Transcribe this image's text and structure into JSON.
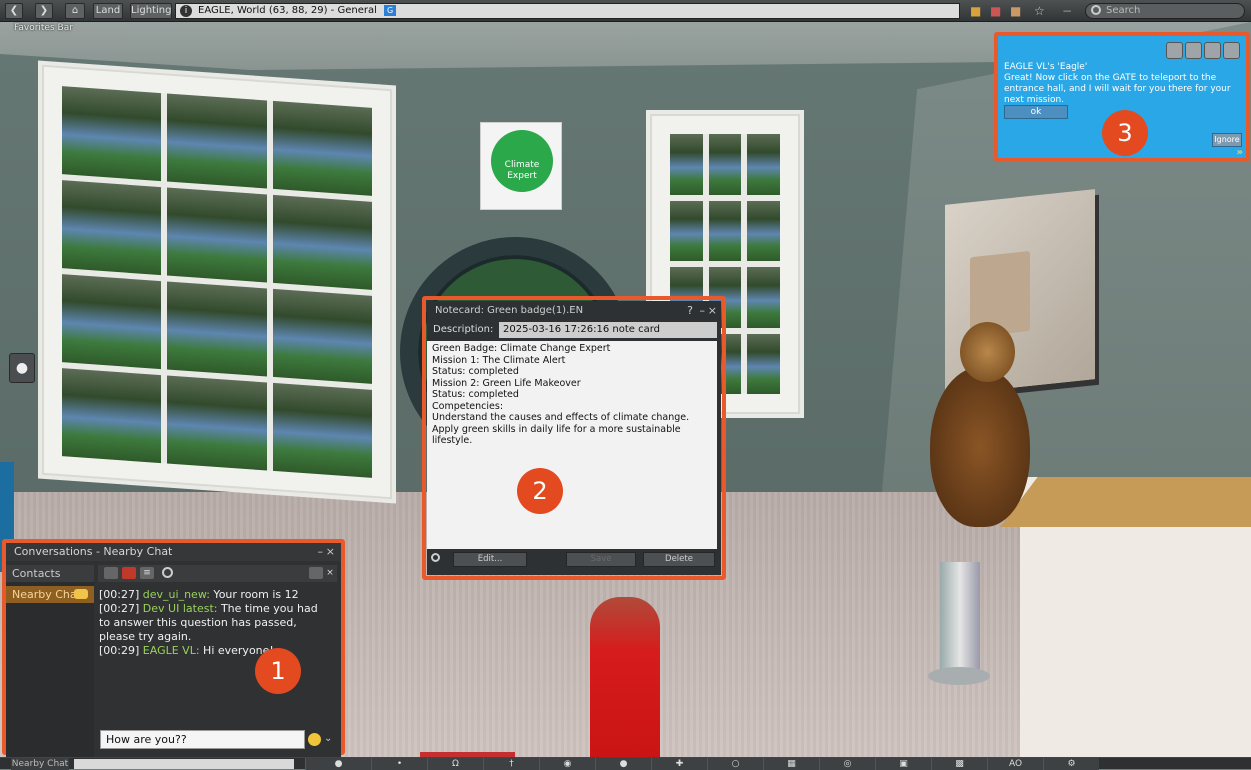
{
  "topbar": {
    "back_icon": "chevron-left-icon",
    "forward_icon": "chevron-right-icon",
    "home_icon": "home-icon",
    "land_label": "Land",
    "lighting_label": "Lighting",
    "location": "EAGLE, World (63, 88, 29) - General",
    "rating_badge": "G",
    "search_placeholder": "Search",
    "favorites_label": "Favorites Bar"
  },
  "conversations": {
    "title": "Conversations - Nearby Chat",
    "contacts_label": "Contacts",
    "active_tab": "Nearby Chat",
    "messages": [
      {
        "time": "[00:27]",
        "sender": "dev_ui_new:",
        "text": " Your room is 12"
      },
      {
        "time": "[00:27]",
        "sender": "Dev UI latest:",
        "text": " The time you had to answer this question has passed, please try again."
      },
      {
        "time": "[00:29]",
        "sender": "EAGLE VL:",
        "text": " Hi everyone!"
      }
    ],
    "input_value": "How are you??"
  },
  "notecard": {
    "title": "Notecard: Green badge(1).EN",
    "description_label": "Description:",
    "description_value": "2025-03-16 17:26:16 note card",
    "body_lines": [
      "Green Badge: Climate Change Expert",
      "",
      "Mission 1: The Climate Alert",
      "Status: completed",
      "",
      "Mission 2: Green Life Makeover",
      "Status: completed",
      "Competencies:",
      "Understand the causes and effects of climate change.",
      "Apply green skills in daily life for a more sustainable lifestyle."
    ],
    "edit_label": "Edit...",
    "save_label": "Save",
    "delete_label": "Delete"
  },
  "notification": {
    "from": "EAGLE VL's 'Eagle'",
    "message": "Great! Now click on the GATE to teleport to the entrance hall, and I will wait for you there for your next mission.",
    "ok_label": "ok",
    "ignore_label": "Ignore"
  },
  "poster": {
    "text_line1": "Climate",
    "text_line2": "Expert"
  },
  "callouts": [
    "1",
    "2",
    "3"
  ],
  "bottombar": {
    "nearby_chat_label": "Nearby Chat",
    "ao_label": "AO"
  },
  "colors": {
    "callout": "#e85a2c",
    "notification_bg": "#2aa7e6",
    "chat_sender": "#9ad25a",
    "active_tab": "#8e5f20"
  }
}
